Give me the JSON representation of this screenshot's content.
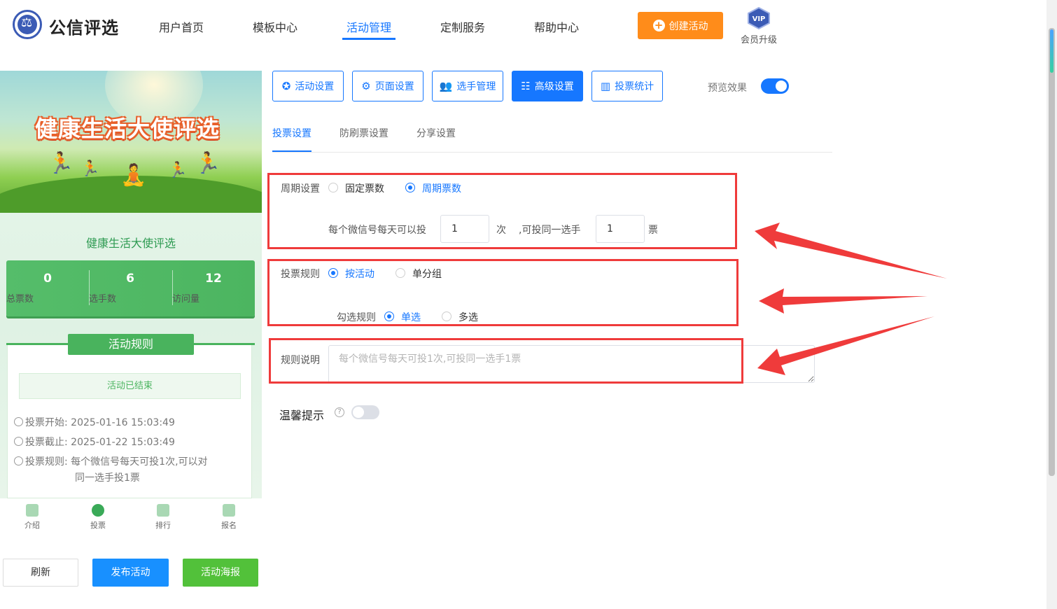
{
  "header": {
    "brand": "公信评选",
    "nav": [
      "用户首页",
      "模板中心",
      "活动管理",
      "定制服务",
      "帮助中心"
    ],
    "active_nav": "活动管理",
    "create_button": "创建活动",
    "vip_badge": "VIP",
    "vip_label": "会员升级"
  },
  "preview": {
    "banner_title": "健康生活大使评选",
    "activity_title": "健康生活大使评选",
    "stats": [
      {
        "value": "0",
        "label": "总票数"
      },
      {
        "value": "6",
        "label": "选手数"
      },
      {
        "value": "12",
        "label": "访问量"
      }
    ],
    "rules_title": "活动规则",
    "ended_notice": "活动已结束",
    "vote_start_label": "投票开始:",
    "vote_start": "2025-01-16 15:03:49",
    "vote_end_label": "投票截止:",
    "vote_end": "2025-01-22 15:03:49",
    "vote_rule_label": "投票规则:",
    "vote_rule_line1": "每个微信号每天可投1次,可以对",
    "vote_rule_line2": "同一选手投1票",
    "tabs": [
      "介绍",
      "投票",
      "排行",
      "报名"
    ]
  },
  "bottom_buttons": {
    "refresh": "刷新",
    "publish": "发布活动",
    "poster": "活动海报"
  },
  "settings_buttons": [
    "活动设置",
    "页面设置",
    "选手管理",
    "高级设置",
    "投票统计"
  ],
  "active_setting": "高级设置",
  "preview_toggle": {
    "label": "预览效果",
    "on": true
  },
  "sub_tabs": [
    "投票设置",
    "防刷票设置",
    "分享设置"
  ],
  "form": {
    "period": {
      "label": "周期设置",
      "options": [
        "固定票数",
        "周期票数"
      ],
      "selected": "周期票数"
    },
    "limit": {
      "prefix": "每个微信号每天可以投",
      "times_value": "1",
      "times_unit": "次",
      "mid": ",可投同一选手",
      "votes_value": "1",
      "votes_unit": "票"
    },
    "vote_rule": {
      "label": "投票规则",
      "options": [
        "按活动",
        "单分组"
      ],
      "selected": "按活动"
    },
    "check_rule": {
      "label": "勾选规则",
      "options": [
        "单选",
        "多选"
      ],
      "selected": "单选"
    },
    "rule_desc": {
      "label": "规则说明",
      "placeholder": "每个微信号每天可投1次,可投同一选手1票"
    },
    "tips": {
      "label": "温馨提示",
      "help": "?",
      "on": false
    }
  },
  "colors": {
    "primary": "#1677ff",
    "orange": "#ff8c1a",
    "green": "#4cb560",
    "annotation_red": "#ef3b3b"
  }
}
